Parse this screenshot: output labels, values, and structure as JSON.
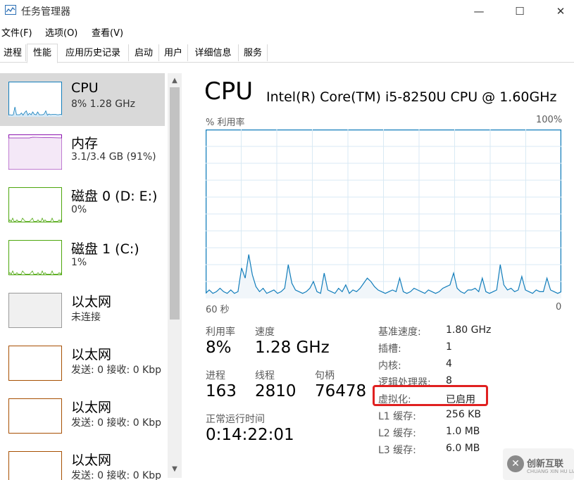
{
  "window": {
    "title": "任务管理器",
    "controls": {
      "minimize": "—",
      "maximize": "☐",
      "close": "✕"
    }
  },
  "menu": [
    "文件(F)",
    "选项(O)",
    "查看(V)"
  ],
  "tabs": [
    {
      "label": "进程",
      "active": false
    },
    {
      "label": "性能",
      "active": true
    },
    {
      "label": "应用历史记录",
      "active": false
    },
    {
      "label": "启动",
      "active": false
    },
    {
      "label": "用户",
      "active": false
    },
    {
      "label": "详细信息",
      "active": false
    },
    {
      "label": "服务",
      "active": false
    }
  ],
  "sidebar": {
    "items": [
      {
        "title": "CPU",
        "subtitle": "8% 1.28 GHz",
        "color": "#117dbb",
        "selected": true
      },
      {
        "title": "内存",
        "subtitle": "3.1/3.4 GB (91%)",
        "color": "#8b12ae",
        "selected": false
      },
      {
        "title": "磁盘 0 (D: E:)",
        "subtitle": "0%",
        "color": "#4da60c",
        "selected": false
      },
      {
        "title": "磁盘 1 (C:)",
        "subtitle": "1%",
        "color": "#4da60c",
        "selected": false
      },
      {
        "title": "以太网",
        "subtitle": "未连接",
        "color": "#9a9a9a",
        "selected": false
      },
      {
        "title": "以太网",
        "subtitle": "发送: 0 接收: 0 Kbp",
        "color": "#a74f01",
        "selected": false
      },
      {
        "title": "以太网",
        "subtitle": "发送: 0 接收: 0 Kbp",
        "color": "#a74f01",
        "selected": false
      },
      {
        "title": "以太网",
        "subtitle": "发送: 0 接收: 0 Kbp",
        "color": "#a74f01",
        "selected": false
      }
    ]
  },
  "main": {
    "title": "CPU",
    "subtitle": "Intel(R) Core(TM) i5-8250U CPU @ 1.60GHz",
    "graph": {
      "label_left": "% 利用率",
      "label_right": "100%",
      "axis_left": "60 秒",
      "axis_right": "0",
      "color": "#117dbb",
      "ymax": 100,
      "usage": [
        3,
        5,
        3,
        4,
        6,
        4,
        3,
        5,
        3,
        4,
        18,
        12,
        26,
        14,
        7,
        4,
        6,
        3,
        4,
        5,
        3,
        4,
        6,
        20,
        9,
        5,
        4,
        3,
        4,
        6,
        10,
        4,
        3,
        15,
        5,
        4,
        3,
        6,
        4,
        8,
        3,
        5,
        4,
        6,
        9,
        12,
        10,
        7,
        5,
        4,
        3,
        4,
        5,
        4,
        12,
        4,
        3,
        4,
        6,
        5,
        4,
        3,
        5,
        4,
        3,
        4,
        6,
        7,
        8,
        15,
        6,
        4,
        3,
        5,
        5,
        6,
        4,
        12,
        4,
        3,
        4,
        5,
        20,
        8,
        5,
        6,
        4,
        5,
        13,
        5,
        4,
        3,
        5,
        4,
        4,
        12,
        5,
        4,
        3,
        4
      ]
    },
    "stats": [
      {
        "label": "利用率",
        "value": "8%"
      },
      {
        "label": "速度",
        "value": "1.28 GHz"
      },
      {
        "label": "进程",
        "value": "163"
      },
      {
        "label": "线程",
        "value": "2810"
      },
      {
        "label": "句柄",
        "value": "76478"
      },
      {
        "label": "正常运行时间",
        "value": "0:14:22:01"
      }
    ],
    "details": [
      {
        "label": "基准速度:",
        "value": "1.80 GHz"
      },
      {
        "label": "插槽:",
        "value": "1"
      },
      {
        "label": "内核:",
        "value": "4"
      },
      {
        "label": "逻辑处理器:",
        "value": "8"
      },
      {
        "label": "虚拟化:",
        "value": "已启用"
      },
      {
        "label": "L1 缓存:",
        "value": "256 KB"
      },
      {
        "label": "L2 缓存:",
        "value": "1.0 MB"
      },
      {
        "label": "L3 缓存:",
        "value": "6.0 MB"
      }
    ]
  },
  "watermark": {
    "mark": "✕",
    "text": "创新互联",
    "sub": "CHUANG XIN HU LIAN"
  }
}
